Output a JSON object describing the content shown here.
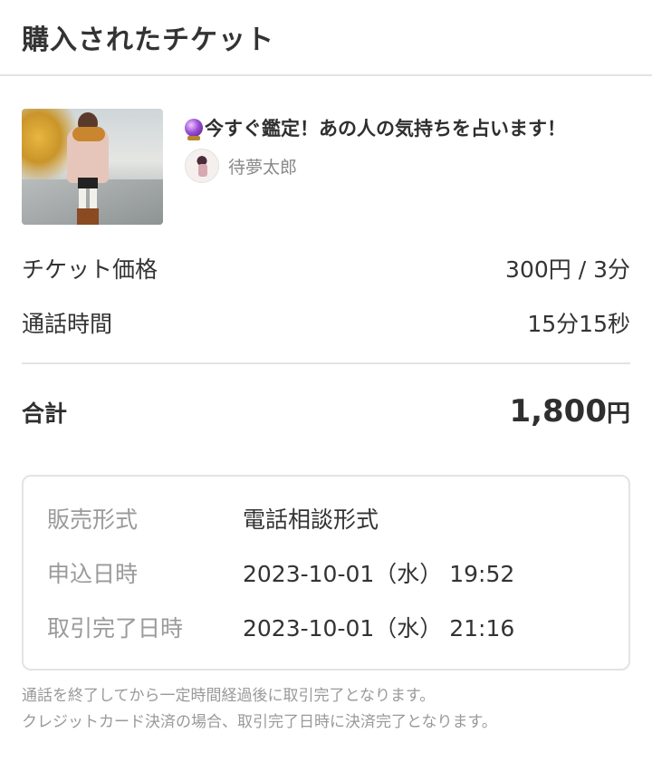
{
  "header": {
    "title": "購入されたチケット"
  },
  "product": {
    "title": "今すぐ鑑定！あの人の気持ちを占います！",
    "title_icon": "crystal-ball-icon",
    "seller_name": "待夢太郎"
  },
  "summary": {
    "price_label": "チケット価格",
    "price_value": "300円 / 3分",
    "time_label": "通話時間",
    "time_value": "15分15秒",
    "total_label": "合計",
    "total_value": "1,800",
    "total_unit": "円"
  },
  "details": {
    "sale_type_label": "販売形式",
    "sale_type_value": "電話相談形式",
    "applied_label": "申込日時",
    "applied_value": "2023-10-01（水） 19:52",
    "completed_label": "取引完了日時",
    "completed_value": "2023-10-01（水） 21:16"
  },
  "notes": {
    "line1": "通話を終了してから一定時間経過後に取引完了となります。",
    "line2": "クレジットカード決済の場合、取引完了日時に決済完了となります。"
  }
}
